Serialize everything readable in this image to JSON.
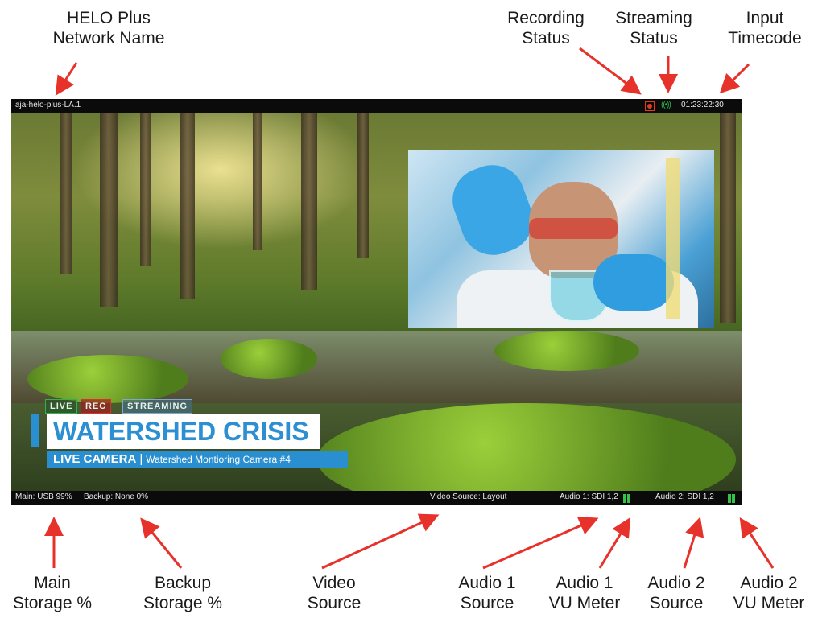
{
  "callouts": {
    "network_name": [
      "HELO Plus",
      "Network Name"
    ],
    "recording_status": [
      "Recording",
      "Status"
    ],
    "streaming_status": [
      "Streaming",
      "Status"
    ],
    "input_timecode": [
      "Input",
      "Timecode"
    ],
    "main_storage": [
      "Main",
      "Storage %"
    ],
    "backup_storage": [
      "Backup",
      "Storage %"
    ],
    "video_source": [
      "Video",
      "Source"
    ],
    "audio1_source": [
      "Audio 1",
      "Source"
    ],
    "audio1_vu": [
      "Audio 1",
      "VU Meter"
    ],
    "audio2_source": [
      "Audio 2",
      "Source"
    ],
    "audio2_vu": [
      "Audio 2",
      "VU Meter"
    ]
  },
  "topbar": {
    "network_name": "aja-helo-plus-LA.1",
    "timecode": "01:23:22:30"
  },
  "bottombar": {
    "main_storage": "Main: USB 99%",
    "backup_storage": "Backup: None 0%",
    "video_source": "Video Source: Layout",
    "audio1": "Audio 1: SDI 1,2",
    "audio2": "Audio 2: SDI 1,2"
  },
  "badges": {
    "live": "LIVE",
    "rec": "REC",
    "streaming": "STREAMING"
  },
  "lower_third": {
    "title": "WATERSHED CRISIS",
    "subtitle_label": "LIVE CAMERA",
    "separator": "|",
    "subtitle_desc": "Watershed Montioring Camera #4"
  },
  "colors": {
    "recording": "#e23a1a",
    "streaming": "#2fb34a",
    "vu_meter": "#33c24a",
    "arrow": "#e6322b",
    "accent_blue": "#2a8fd0"
  }
}
